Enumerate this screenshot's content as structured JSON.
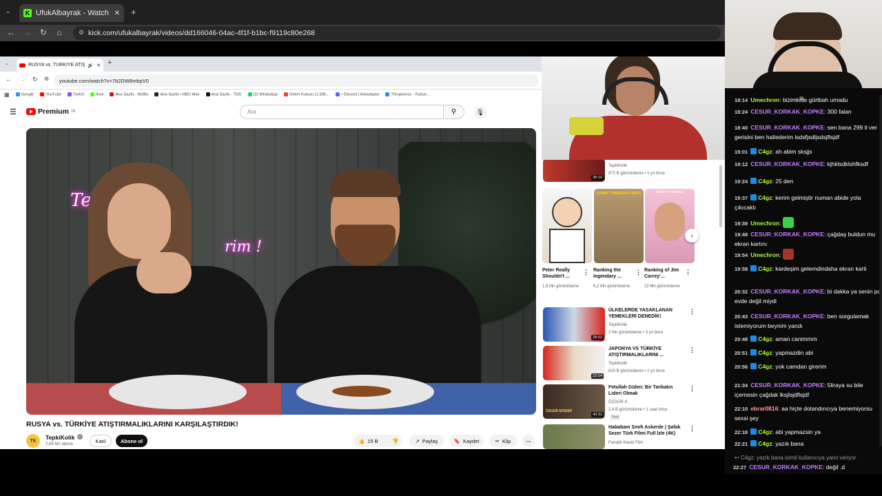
{
  "outer_browser": {
    "tab_title": "UfukAlbayrak - Watch the V",
    "url": "kick.com/ufukalbayrak/videos/dd166046-04ac-4f1f-b1bc-f9119c80e268"
  },
  "inner_browser": {
    "tab_title": "RUSYA vs. TÜRKİYE ATIŞTIR",
    "url": "youtube.com/watch?v=7b2DW8mbpV0",
    "bookmarks": [
      "Google",
      "YouTube",
      "Twitch",
      "Kick",
      "Ana Sayfa - Netflix",
      "Ana Sayfa • HBO Max",
      "Ana Sayfa - TOD",
      "(2) WhatsApp",
      "Gelen Kutusu (1.595...",
      "• Discord | Arkadaşlar",
      "Thingiverse - Fçikse..."
    ]
  },
  "youtube": {
    "logo": "Premium",
    "logo_sup": "TR",
    "search_placeholder": "Ara",
    "video": {
      "neon_text": "Tepki ver",
      "neon_text2": "rim !",
      "title": "RUSYA vs. TÜRKİYE ATIŞTIRMALIKLARINI KARŞILAŞTIRDIK!",
      "channel": "TepkiKolik",
      "channel_avatar": "TK",
      "subscribers": "2,69 Mn abone",
      "join": "Katıl",
      "subscribe": "Abone ol",
      "likes": "15 B",
      "share": "Paylaş",
      "save": "Kaydet",
      "clip": "Klip"
    },
    "recs_top": {
      "channel": "TepkiKolik",
      "meta": "872 B görüntüleme • 1 yıl önce",
      "duration": "38:10"
    },
    "shorts": [
      {
        "title": "Peter Really Shouldn't ...",
        "views": "1,6 Mn görüntüleme"
      },
      {
        "title": "Ranking the legendary ...",
        "views": "6,2 Mn görüntüleme"
      },
      {
        "title": "Ranking of Jim Carrey'...",
        "views": "22 Mn görüntüleme"
      }
    ],
    "short_labels": [
      "FUNNY COMEDIAN CHEFS",
      "science moments"
    ],
    "recs": [
      {
        "title": "ÜLKELERDE YASAKLANAN YEMEKLERİ DENEDİK!",
        "channel": "TepkiKolik",
        "meta": "2 Mn görüntüleme • 3 yıl önce",
        "duration": "28:02"
      },
      {
        "title": "JAPONYA VS TÜRKİYE ATIŞTIRMALIKLARINI ...",
        "channel": "TepkiKolik",
        "meta": "620 B görüntüleme • 2 yıl önce",
        "duration": "22:04"
      },
      {
        "title": "Fetullah Gülen: Bir Tarikatın Lideri Olmak",
        "channel": "ÖZGÜR X",
        "meta": "2,4 B görüntüleme • 1 saat önce",
        "badge": "Yeni",
        "duration": "43:31",
        "thumb_text": "ÖZGÜR EFENDİ"
      },
      {
        "title": "Hababam Sınıfı Askerde | Şafak Sezer Türk Filmi Full İzle (4K)",
        "channel": "Fanatik Klasik Film",
        "meta": "",
        "duration": ""
      }
    ]
  },
  "chat": {
    "messages": [
      {
        "time": "18:14",
        "user": "Umechron",
        "text": "bizimkide güribah  umadu",
        "color": "#b3ff3a",
        "badge": false
      },
      {
        "time": "18:24",
        "user": "CESUR_KORKAK_KOPKE",
        "text": "300 falan",
        "color": "#c77dff",
        "badge": false
      },
      {
        "time": "18:40",
        "user": "CESUR_KORKAK_KOPKE",
        "text": "sen bana 299 tl ver gerisini ben hallederim lsdsfjsdljsdsjflsjdf",
        "color": "#c77dff",
        "badge": false
      },
      {
        "time": "19:01",
        "user": "C4gz",
        "text": "ah abim sksjjs",
        "color": "#b3ff3a",
        "badge": true
      },
      {
        "time": "19:12",
        "user": "CESUR_KORKAK_KOPKE",
        "text": "kjhklsdklshfksdf",
        "color": "#c77dff",
        "badge": false
      },
      {
        "time": "19:24",
        "user": "C4gz",
        "text": "25 den",
        "color": "#b3ff3a",
        "badge": true
      },
      {
        "time": "19:37",
        "user": "C4gz",
        "text": "kerim gelmiştir numan abide yola çıkıcaktı",
        "color": "#b3ff3a",
        "badge": true
      },
      {
        "time": "19:39",
        "user": "Umechron",
        "text": "",
        "color": "#b3ff3a",
        "badge": false,
        "emote": "green"
      },
      {
        "time": "19:48",
        "user": "CESUR_KORKAK_KOPKE",
        "text": "çağdaş buldun mu ekran kartını",
        "color": "#c77dff",
        "badge": false
      },
      {
        "time": "19:54",
        "user": "Umechron",
        "text": "",
        "color": "#b3ff3a",
        "badge": false,
        "emote": "red"
      },
      {
        "time": "19:59",
        "user": "C4gz",
        "text": "kardeşim gelemdindaha ekran karti",
        "color": "#b3ff3a",
        "badge": true
      },
      {
        "time": "20:32",
        "user": "CESUR_KORKAK_KOPKE",
        "text": "bi dakka ya senin pc evde değil miydi",
        "color": "#c77dff",
        "badge": false
      },
      {
        "time": "20:43",
        "user": "CESUR_KORKAK_KOPKE",
        "text": "ben sorgulamak istemiyorum beynim yandı",
        "color": "#c77dff",
        "badge": false
      },
      {
        "time": "20:48",
        "user": "C4gz",
        "text": "aman canimmm",
        "color": "#b3ff3a",
        "badge": true
      },
      {
        "time": "20:51",
        "user": "C4gz",
        "text": "yapmazdin abi",
        "color": "#b3ff3a",
        "badge": true
      },
      {
        "time": "20:56",
        "user": "C4gz",
        "text": "yok camdan girerim",
        "color": "#b3ff3a",
        "badge": true
      },
      {
        "time": "21:34",
        "user": "CESUR_KORKAK_KOPKE",
        "text": "5liraya su bile içemesin çağdak lksjlsjdflsjdf",
        "color": "#c77dff",
        "badge": false
      },
      {
        "time": "22:10",
        "user": "ebrar0816",
        "text": "aa hiçte dolandırıcıya benemiyorsu sexsi şey",
        "color": "#ff9aa2",
        "badge": false
      },
      {
        "time": "22:18",
        "user": "C4gz",
        "text": "abi yapmazsin ya",
        "color": "#b3ff3a",
        "badge": true
      },
      {
        "time": "22:21",
        "user": "C4gz",
        "text": "yazık bana",
        "color": "#b3ff3a",
        "badge": true
      }
    ],
    "reply_to": "C4gz: yazık bana isimli kullanıcıya yanıt veriyor",
    "last": {
      "time": "22:27",
      "user": "CESUR_KORKAK_KOPKE",
      "text": "değil .d",
      "color": "#c77dff"
    }
  },
  "colors": {
    "kick_green": "#53fc18",
    "yt_red": "#ff0000",
    "chat_bg": "#0a0a0a"
  }
}
